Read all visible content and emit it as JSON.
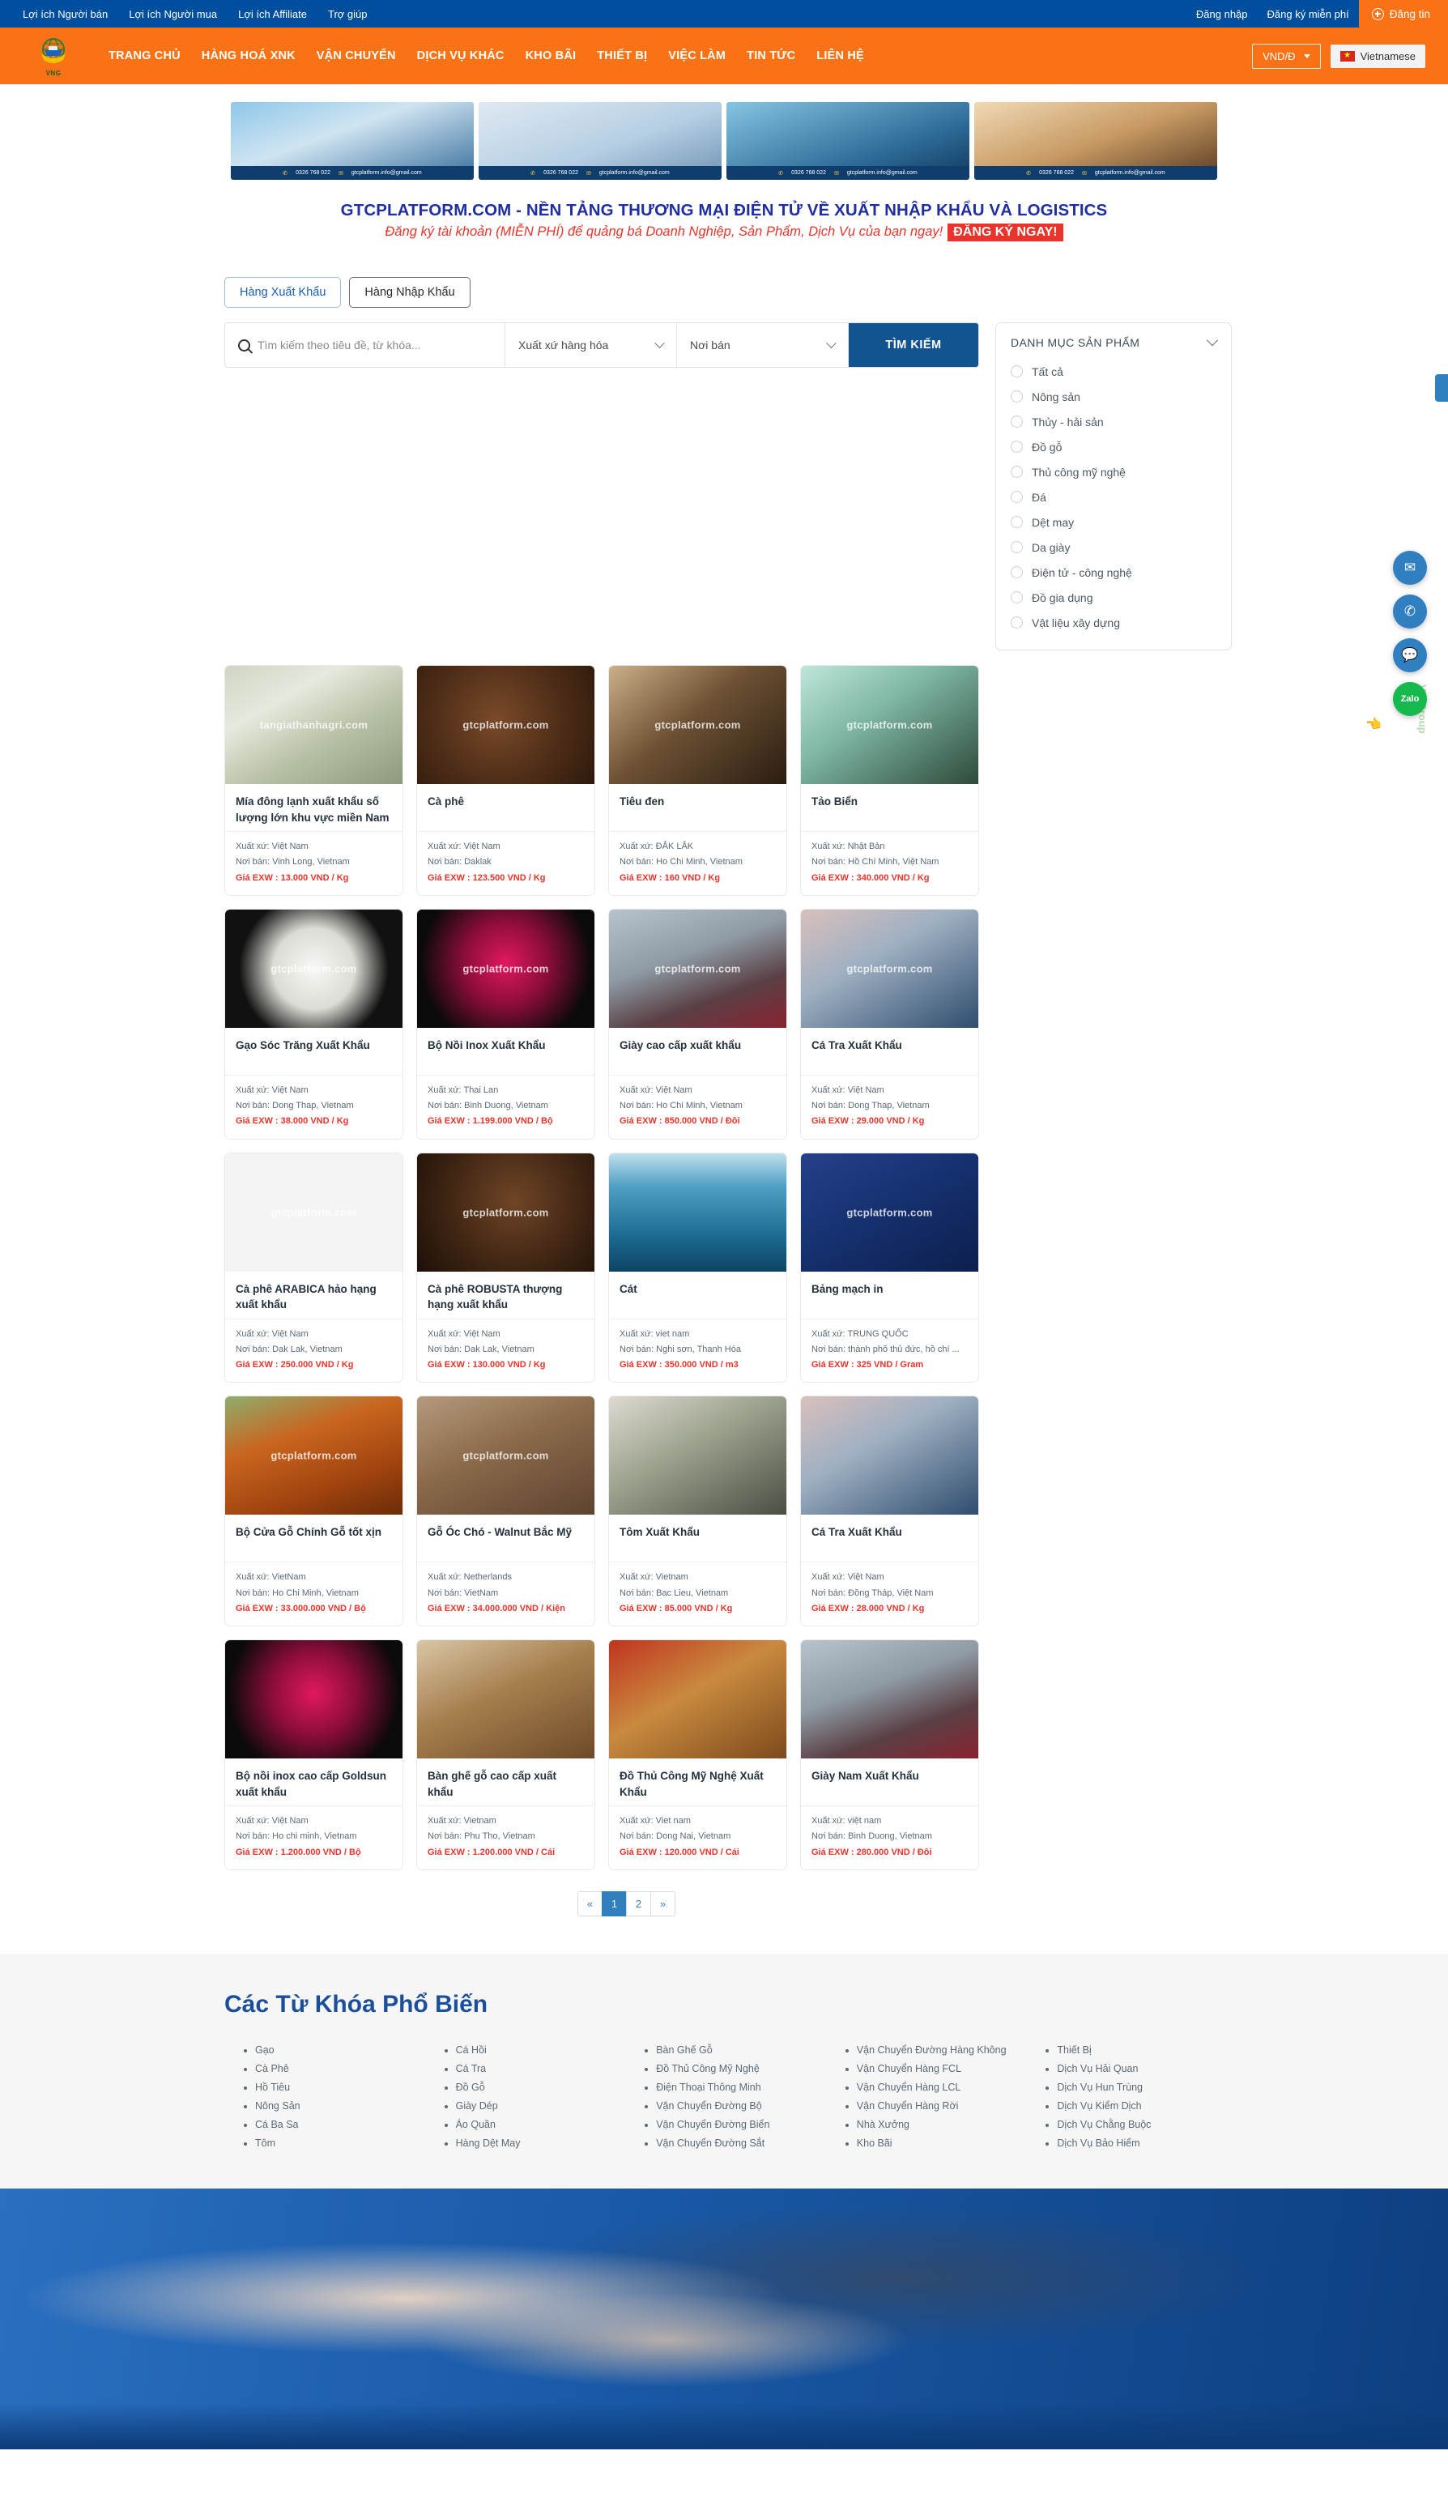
{
  "topbar": {
    "links": [
      {
        "label": "Lợi ích Người bán"
      },
      {
        "label": "Lợi ích Người mua"
      },
      {
        "label": "Lợi ích Affiliate"
      },
      {
        "label": "Trợ giúp"
      }
    ],
    "login": "Đăng nhập",
    "register": "Đăng ký miễn phí",
    "post": "Đăng tin"
  },
  "nav": {
    "logo_text": "VNG",
    "items": [
      {
        "label": "TRANG CHỦ"
      },
      {
        "label": "HÀNG HOÁ XNK"
      },
      {
        "label": "VẬN CHUYỂN"
      },
      {
        "label": "DỊCH VỤ KHÁC"
      },
      {
        "label": "KHO BÃI"
      },
      {
        "label": "THIẾT BỊ"
      },
      {
        "label": "VIỆC LÀM"
      },
      {
        "label": "TIN TỨC"
      },
      {
        "label": "LIÊN HỆ"
      }
    ],
    "currency": "VND/Đ",
    "language": "Vietnamese"
  },
  "banners": [
    {
      "phone": "0326 768 022",
      "email": "gtcplatform.info@gmail.com"
    },
    {
      "phone": "0326 768 022",
      "email": "gtcplatform.info@gmail.com"
    },
    {
      "phone": "0326 768 022",
      "email": "gtcplatform.info@gmail.com"
    },
    {
      "phone": "0326 768 022",
      "email": "gtcplatform.info@gmail.com"
    }
  ],
  "hero": {
    "title": "GTCPLATFORM.COM - NỀN TẢNG THƯƠNG MẠI ĐIỆN TỬ VỀ XUẤT NHẬP KHẨU VÀ LOGISTICS",
    "subtitle": "Đăng ký tài khoản (MIỄN PHÍ) để quảng bá Doanh Nghiệp, Sản Phẩm, Dịch Vụ của bạn ngay!",
    "cta": "ĐĂNG KÝ NGAY!"
  },
  "tabs": [
    {
      "label": "Hàng Xuất Khẩu",
      "active": true
    },
    {
      "label": "Hàng Nhập Khẩu",
      "active": false
    }
  ],
  "search": {
    "placeholder": "Tìm kiếm theo tiêu đề, từ khóa...",
    "value": "",
    "origin_select": "Xuất xứ hàng hóa",
    "place_select": "Nơi bán",
    "button": "TÌM KIẾM"
  },
  "category_panel": {
    "title": "DANH MỤC SẢN PHẨM",
    "items": [
      {
        "label": "Tất cả"
      },
      {
        "label": "Nông sản"
      },
      {
        "label": "Thủy - hải sản"
      },
      {
        "label": "Đồ gỗ"
      },
      {
        "label": "Thủ công mỹ nghệ"
      },
      {
        "label": "Đá"
      },
      {
        "label": "Dệt may"
      },
      {
        "label": "Da giày"
      },
      {
        "label": "Điện tử - công nghệ"
      },
      {
        "label": "Đồ gia dụng"
      },
      {
        "label": "Vật liệu xây dựng"
      }
    ]
  },
  "labels": {
    "origin": "Xuất xứ:",
    "seller_place": "Nơi bán:",
    "price": "Giá EXW :"
  },
  "products": [
    {
      "title": "Mía đông lạnh xuất khẩu số lượng lớn khu vực miền Nam",
      "origin": "Việt Nam",
      "place": "Vinh Long, Vietnam",
      "price": "13.000 VND / Kg",
      "img": "ph-sugar",
      "wm": "tangiathanhagri.com"
    },
    {
      "title": "Cà phê",
      "origin": "Việt Nam",
      "place": "Daklak",
      "price": "123.500 VND / Kg",
      "img": "ph-coffee",
      "wm": "gtcplatform.com"
    },
    {
      "title": "Tiêu đen",
      "origin": "ĐẮK LẮK",
      "place": "Ho Chi Minh, Vietnam",
      "price": "160 VND / Kg",
      "img": "ph-pepper",
      "wm": "gtcplatform.com"
    },
    {
      "title": "Tảo Biển",
      "origin": "Nhật Bản",
      "place": "Hồ Chí Minh, Việt Nam",
      "price": "340.000 VND / Kg",
      "img": "ph-algae",
      "wm": "gtcplatform.com"
    },
    {
      "title": "Gạo Sóc Trăng Xuất Khẩu",
      "origin": "Việt Nam",
      "place": "Dong Thap, Vietnam",
      "price": "38.000 VND / Kg",
      "img": "ph-rice",
      "wm": "gtcplatform.com"
    },
    {
      "title": "Bộ Nồi Inox Xuất Khẩu",
      "origin": "Thai Lan",
      "place": "Binh Duong, Vietnam",
      "price": "1.199.000 VND / Bộ",
      "img": "ph-pots",
      "wm": "gtcplatform.com"
    },
    {
      "title": "Giày cao cấp xuất khẩu",
      "origin": "Việt Nam",
      "place": "Ho Chi Minh, Vietnam",
      "price": "850.000 VND / Đôi",
      "img": "ph-shoes",
      "wm": "gtcplatform.com"
    },
    {
      "title": "Cá Tra Xuất Khẩu",
      "origin": "Việt Nam",
      "place": "Dong Thap, Vietnam",
      "price": "29.000 VND / Kg",
      "img": "ph-fish",
      "wm": "gtcplatform.com"
    },
    {
      "title": "Cà phê ARABICA hảo hạng xuất khẩu",
      "origin": "Việt Nam",
      "place": "Dak Lak, Vietnam",
      "price": "250.000 VND / Kg",
      "img": "ph-arab",
      "wm": "gtcplatform.com"
    },
    {
      "title": "Cà phê ROBUSTA thượng hạng xuất khẩu",
      "origin": "Việt Nam",
      "place": "Dak Lak, Vietnam",
      "price": "130.000 VND / Kg",
      "img": "ph-robu",
      "wm": "gtcplatform.com"
    },
    {
      "title": "Cát",
      "origin": "viet nam",
      "place": "Nghi sơn, Thanh Hóa",
      "price": "350.000 VND / m3",
      "img": "ph-sand",
      "wm": ""
    },
    {
      "title": "Bảng mạch in",
      "origin": "TRUNG QUỐC",
      "place": "thành phố thủ đức, hồ chí ...",
      "price": "325 VND / Gram",
      "img": "ph-pcb",
      "wm": "gtcplatform.com"
    },
    {
      "title": "Bộ Cửa Gỗ Chính Gỗ tốt xịn",
      "origin": "VietNam",
      "place": "Ho Chi Minh, Vietnam",
      "price": "33.000.000 VND / Bộ",
      "img": "ph-door",
      "wm": "gtcplatform.com"
    },
    {
      "title": "Gỗ Óc Chó - Walnut Bắc Mỹ",
      "origin": "Netherlands",
      "place": "VietNam",
      "price": "34.000.000 VND / Kiện",
      "img": "ph-wood",
      "wm": "gtcplatform.com"
    },
    {
      "title": "Tôm Xuất Khẩu",
      "origin": "Vietnam",
      "place": "Bac Lieu, Vietnam",
      "price": "85.000 VND / Kg",
      "img": "ph-shrimp",
      "wm": ""
    },
    {
      "title": "Cá Tra Xuất Khẩu",
      "origin": "Việt Nam",
      "place": "Đồng Tháp, Việt Nam",
      "price": "28.000 VND / Kg",
      "img": "ph-fish",
      "wm": ""
    },
    {
      "title": "Bộ nồi inox cao cấp Goldsun xuất khẩu",
      "origin": "Việt Nam",
      "place": "Ho chi minh, Vietnam",
      "price": "1.200.000 VND / Bộ",
      "img": "ph-pots",
      "wm": ""
    },
    {
      "title": "Bàn ghế gỗ cao cấp xuất khẩu",
      "origin": "Vietnam",
      "place": "Phu Tho, Vietnam",
      "price": "1.200.000 VND / Cái",
      "img": "ph-table",
      "wm": ""
    },
    {
      "title": "Đồ Thủ Công Mỹ Nghệ Xuất Khẩu",
      "origin": "Viet nam",
      "place": "Dong Nai, Vietnam",
      "price": "120.000 VND / Cái",
      "img": "ph-craft",
      "wm": ""
    },
    {
      "title": "Giày Nam Xuất Khẩu",
      "origin": "việt nam",
      "place": "Binh Duong, Vietnam",
      "price": "280.000 VND / Đôi",
      "img": "ph-shoes",
      "wm": ""
    }
  ],
  "pagination": {
    "prev": "«",
    "pages": [
      "1",
      "2"
    ],
    "current": "1",
    "next": "»"
  },
  "keywords": {
    "title": "Các Từ Khóa Phổ Biến",
    "columns": [
      [
        "Gạo",
        "Cà Phê",
        "Hồ Tiêu",
        "Nông Sản",
        "Cá Ba Sa",
        "Tôm"
      ],
      [
        "Cá Hồi",
        "Cá Tra",
        "Đồ Gỗ",
        "Giày Dép",
        "Áo Quần",
        "Hàng Dệt May"
      ],
      [
        "Bàn Ghế Gỗ",
        "Đồ Thủ Công Mỹ Nghệ",
        "Điện Thoại Thông Minh",
        "Vận Chuyển Đường Bộ",
        "Vận Chuyển Đường Biển",
        "Vận Chuyển Đường Sắt"
      ],
      [
        "Vận Chuyển Đường Hàng Không",
        "Vận Chuyển Hàng FCL",
        "Vận Chuyển Hàng LCL",
        "Vận Chuyển Hàng Rời",
        "Nhà Xưởng",
        "Kho Bãi"
      ],
      [
        "Thiết Bị",
        "Dịch Vụ Hải Quan",
        "Dịch Vụ Hun Trùng",
        "Dịch Vụ Kiểm Dịch",
        "Dịch Vụ Chằng Buộc",
        "Dịch Vụ Bảo Hiểm"
      ]
    ]
  },
  "float_widgets": {
    "mail": "✉",
    "phone": "✆",
    "chat": "💬",
    "zalo": "Zalo",
    "vertical_text": "VN Group"
  }
}
